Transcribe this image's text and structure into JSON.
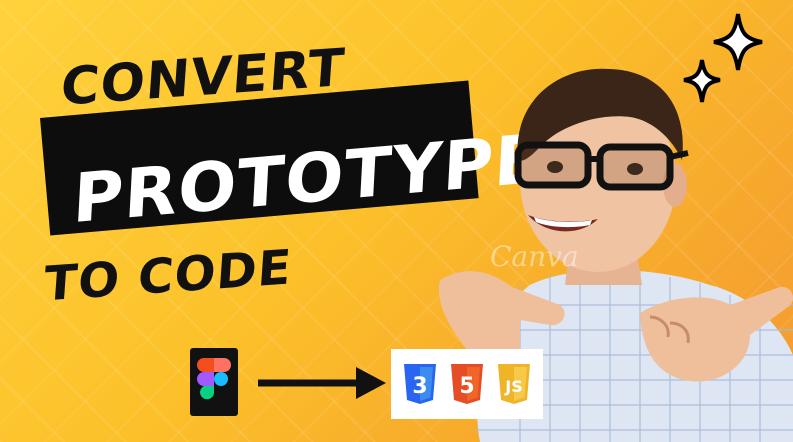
{
  "headline": {
    "line1": "CONVERT",
    "line2": "PROTOTYPE",
    "line3": "TO CODE"
  },
  "watermark": "Canva",
  "icons": {
    "sparkle": "sparkle-icon",
    "figma": "figma-logo-icon",
    "arrow": "arrow-right-icon",
    "css": "css3-logo-icon",
    "html": "html5-logo-icon",
    "js": "js-logo-icon"
  },
  "tech_labels": {
    "css": "3",
    "html": "5",
    "js": "JS"
  },
  "colors": {
    "background_start": "#ffd23c",
    "background_end": "#f29a34",
    "banner": "#0d0d0d",
    "css_blue": "#2965f1",
    "html_orange": "#e44d26",
    "js_yellow": "#f0b429"
  }
}
